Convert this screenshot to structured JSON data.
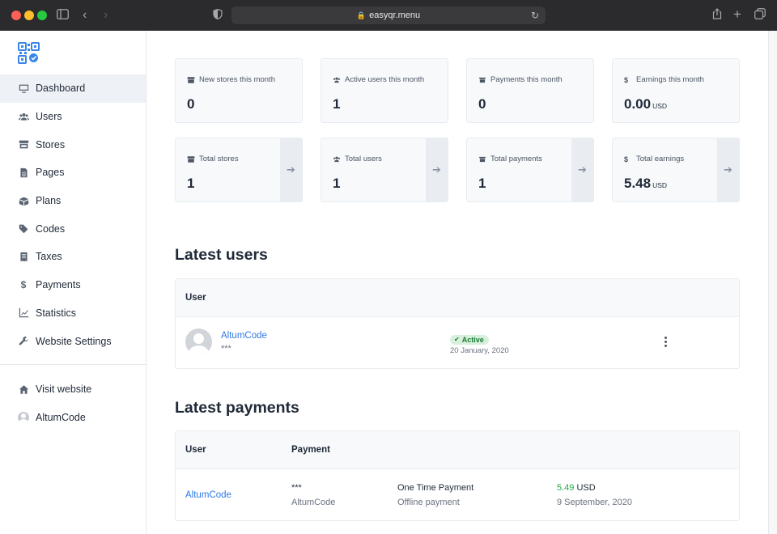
{
  "browser": {
    "url": "easyqr.menu"
  },
  "sidebar": {
    "items": [
      {
        "label": "Dashboard",
        "icon": "monitor-icon",
        "active": true
      },
      {
        "label": "Users",
        "icon": "users-icon"
      },
      {
        "label": "Stores",
        "icon": "store-icon"
      },
      {
        "label": "Pages",
        "icon": "file-icon"
      },
      {
        "label": "Plans",
        "icon": "box-icon"
      },
      {
        "label": "Codes",
        "icon": "tags-icon"
      },
      {
        "label": "Taxes",
        "icon": "receipt-icon"
      },
      {
        "label": "Payments",
        "icon": "dollar-icon"
      },
      {
        "label": "Statistics",
        "icon": "chart-icon"
      },
      {
        "label": "Website Settings",
        "icon": "wrench-icon"
      }
    ],
    "footer_items": [
      {
        "label": "Visit website",
        "icon": "home-icon"
      },
      {
        "label": "AltumCode",
        "icon": "avatar-icon"
      }
    ]
  },
  "stats_month": [
    {
      "label": "New stores this month",
      "value": "0",
      "icon": "store-icon"
    },
    {
      "label": "Active users this month",
      "value": "1",
      "icon": "users-icon"
    },
    {
      "label": "Payments this month",
      "value": "0",
      "icon": "payment-icon"
    },
    {
      "label": "Earnings this month",
      "value": "0.00",
      "unit": "USD",
      "icon": "dollar-icon"
    }
  ],
  "stats_total": [
    {
      "label": "Total stores",
      "value": "1",
      "icon": "store-icon"
    },
    {
      "label": "Total users",
      "value": "1",
      "icon": "users-icon"
    },
    {
      "label": "Total payments",
      "value": "1",
      "icon": "payment-icon"
    },
    {
      "label": "Total earnings",
      "value": "5.48",
      "unit": "USD",
      "icon": "dollar-icon"
    }
  ],
  "latest_users": {
    "title": "Latest users",
    "header_user": "User",
    "rows": [
      {
        "name": "AltumCode",
        "email": "***",
        "status": "Active",
        "date": "20 January, 2020"
      }
    ]
  },
  "latest_payments": {
    "title": "Latest payments",
    "header_user": "User",
    "header_payment": "Payment",
    "rows": [
      {
        "user": "AltumCode",
        "payer_email": "***",
        "payer_name": "AltumCode",
        "type": "One Time Payment",
        "method": "Offline payment",
        "amount": "5.49",
        "currency": "USD",
        "date": "9 September, 2020"
      }
    ]
  },
  "colors": {
    "accent": "#2f7ae5",
    "active_badge_bg": "#d7f0dd",
    "active_badge_text": "#1d7a34",
    "amount_green": "#28a745"
  }
}
